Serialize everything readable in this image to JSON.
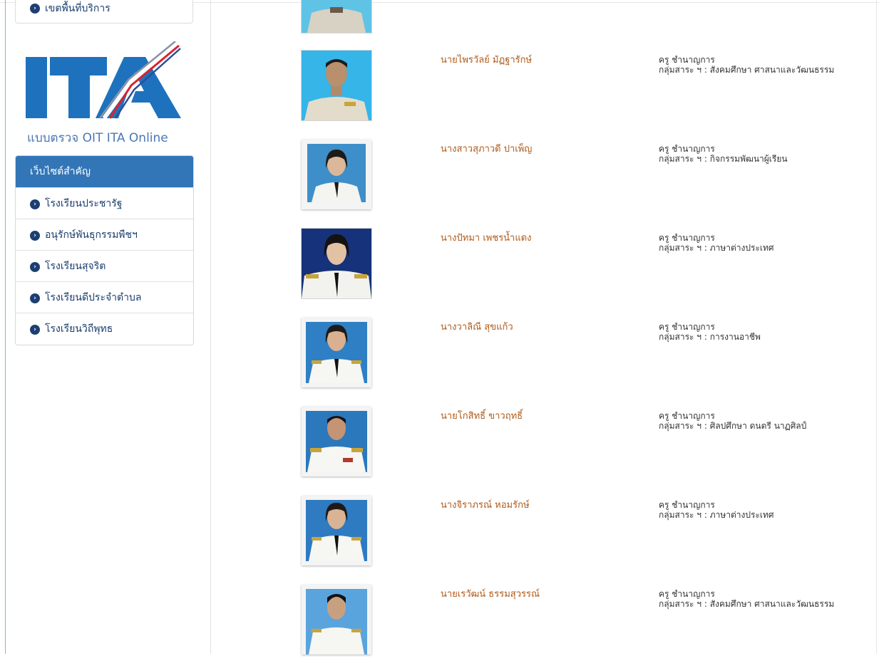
{
  "sidebar": {
    "top_link": "เขตพื้นที่บริการ",
    "ita_caption": "แบบตรวจ OIT ITA Online",
    "panel_title": "เว็บไซต์สำคัญ",
    "links": [
      "โรงเรียนประชารัฐ",
      "อนุรักษ์พันธุกรรมพืชฯ",
      "โรงเรียนสุจริต",
      "โรงเรียนดีประจำตำบล",
      "โรงเรียนวิถีพุทธ"
    ]
  },
  "colors": {
    "accent": "#3276b8",
    "name_color": "#b05a18",
    "link_color": "#1a3d6e"
  },
  "staff": [
    {
      "name": "นายไพรวัลย์ มัฏฐารักษ์",
      "position": "ครู ชำนาญการ",
      "group": "กลุ่มสาระ ฯ : สังคมศึกษา ศาสนาและวัฒนธรรม"
    },
    {
      "name": "นางสาวสุภาวดี ปาเพ็ญ",
      "position": "ครู ชำนาญการ",
      "group": "กลุ่มสาระ ฯ : กิจกรรมพัฒนาผู้เรียน"
    },
    {
      "name": "นางปัทมา เพชรน้ำแดง",
      "position": "ครู ชำนาญการ",
      "group": "กลุ่มสาระ ฯ : ภาษาต่างประเทศ"
    },
    {
      "name": "นางวาลิณี สุขแก้ว",
      "position": "ครู ชำนาญการ",
      "group": "กลุ่มสาระ ฯ : การงานอาชีพ"
    },
    {
      "name": "นายโกสิทธิ์ ขาวฤทธิ์",
      "position": "ครู ชำนาญการ",
      "group": "กลุ่มสาระ ฯ : ศิลปศึกษา ดนตรี นาฏศิลป์"
    },
    {
      "name": "นางจิราภรณ์ หอมรักษ์",
      "position": "ครู ชำนาญการ",
      "group": "กลุ่มสาระ ฯ : ภาษาต่างประเทศ"
    },
    {
      "name": "นายเรวัฒน์ ธรรมสุวรรณ์",
      "position": "ครู ชำนาญการ",
      "group": "กลุ่มสาระ ฯ : สังคมศึกษา ศาสนาและวัฒนธรรม"
    }
  ]
}
